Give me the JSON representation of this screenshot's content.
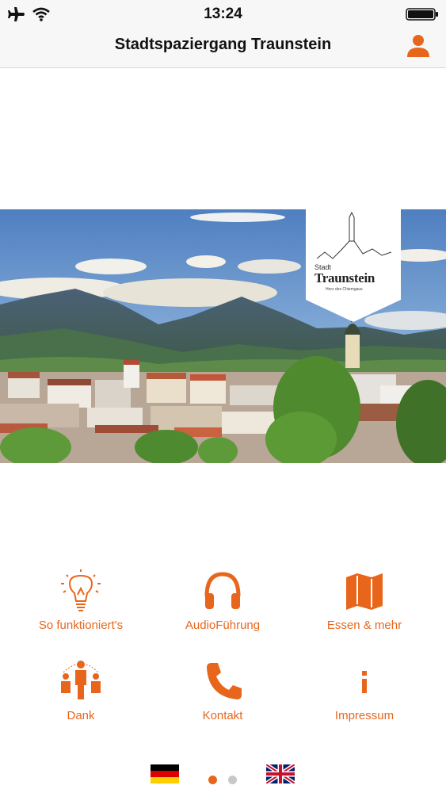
{
  "status_bar": {
    "time": "13:24"
  },
  "header": {
    "title": "Stadtspaziergang Traunstein"
  },
  "logo": {
    "small": "Stadt",
    "main": "Traunstein",
    "sub": "Herz des Chiemgaus"
  },
  "menu": [
    {
      "label": "So funktioniert's",
      "icon": "lightbulb-icon"
    },
    {
      "label": "AudioFührung",
      "icon": "headphones-icon"
    },
    {
      "label": "Essen & mehr",
      "icon": "map-icon"
    },
    {
      "label": "Dank",
      "icon": "people-icon"
    },
    {
      "label": "Kontakt",
      "icon": "phone-icon"
    },
    {
      "label": "Impressum",
      "icon": "info-icon"
    }
  ],
  "pager": {
    "pages": 2,
    "current": 1
  },
  "languages": [
    {
      "icon": "german-flag-icon"
    },
    {
      "icon": "uk-flag-icon"
    }
  ],
  "colors": {
    "accent": "#e8661c",
    "bar_background": "#f7f7f7",
    "dot_active": "#e8661c",
    "dot_inactive": "#c8c8c8"
  }
}
